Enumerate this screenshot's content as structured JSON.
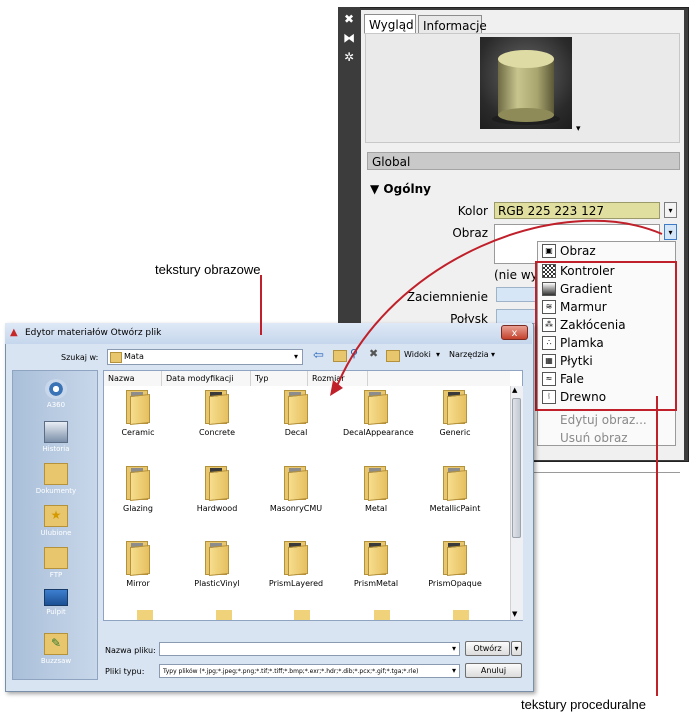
{
  "material_editor": {
    "tabs": [
      {
        "label": "Wygląd"
      },
      {
        "label": "Informacje"
      }
    ],
    "preview_caret": "▾",
    "global_label": "Global",
    "section": {
      "arrow": "▼",
      "label": "Ogólny"
    },
    "color": {
      "label": "Kolor",
      "value": "RGB 225 223 127"
    },
    "image": {
      "label": "Obraz"
    },
    "no_image_partial": "(nie wy",
    "shading_label": "Zaciemnienie",
    "gloss_label": "Połysk",
    "dropdown_arrow": "▾",
    "side_icons": [
      "close-icon",
      "pin-icon",
      "settings-icon"
    ],
    "dropdown": {
      "header": "Obraz",
      "items": [
        {
          "label": "Kontroler",
          "icon": "checker-icon"
        },
        {
          "label": "Gradient",
          "icon": "gradient-icon"
        },
        {
          "label": "Marmur",
          "icon": "marble-icon"
        },
        {
          "label": "Zakłócenia",
          "icon": "noise-icon"
        },
        {
          "label": "Plamka",
          "icon": "speckle-icon"
        },
        {
          "label": "Płytki",
          "icon": "tiles-icon"
        },
        {
          "label": "Fale",
          "icon": "waves-icon"
        },
        {
          "label": "Drewno",
          "icon": "wood-icon"
        }
      ],
      "disabled_items": [
        {
          "label": "Edytuj obraz..."
        },
        {
          "label": "Usuń obraz"
        }
      ]
    }
  },
  "file_dialog": {
    "title": "Edytor materiałów Otwórz plik",
    "close_label": "x",
    "lookin_label": "Szukaj w:",
    "lookin_value": "Mata",
    "views_label": "Widoki",
    "tools_label": "Narzędzia",
    "places": [
      {
        "label": "A360",
        "icon": "a360-icon"
      },
      {
        "label": "Historia",
        "icon": "history-icon"
      },
      {
        "label": "Dokumenty",
        "icon": "documents-icon"
      },
      {
        "label": "Ulubione",
        "icon": "favorites-icon"
      },
      {
        "label": "FTP",
        "icon": "ftp-icon"
      },
      {
        "label": "Pulpit",
        "icon": "desktop-icon"
      },
      {
        "label": "Buzzsaw",
        "icon": "buzzsaw-icon"
      }
    ],
    "columns": [
      {
        "label": "Nazwa"
      },
      {
        "label": "Data modyfikacji"
      },
      {
        "label": "Typ"
      },
      {
        "label": "Rozmiar"
      }
    ],
    "folders": [
      {
        "name": "Ceramic"
      },
      {
        "name": "Concrete"
      },
      {
        "name": "Decal"
      },
      {
        "name": "DecalAppearance"
      },
      {
        "name": "Generic"
      },
      {
        "name": "Glazing"
      },
      {
        "name": "Hardwood"
      },
      {
        "name": "MasonryCMU"
      },
      {
        "name": "Metal"
      },
      {
        "name": "MetallicPaint"
      },
      {
        "name": "Mirror"
      },
      {
        "name": "PlasticVinyl"
      },
      {
        "name": "PrismLayered"
      },
      {
        "name": "PrismMetal"
      },
      {
        "name": "PrismOpaque"
      }
    ],
    "filename_label": "Nazwa pliku:",
    "filename_value": "",
    "filetype_label": "Pliki typu:",
    "filetype_value": "Typy plików  (*.jpg;*.jpeg;*.png;*.tif;*.tiff;*.bmp;*.exr;*.hdr;*.dib;*.pcx;*.gif;*.tga;*.rle)",
    "open_button": "Otwórz",
    "cancel_button": "Anuluj"
  },
  "annotations": {
    "image_textures": "tekstury obrazowe",
    "procedural_textures": "tekstury proceduralne"
  },
  "colors": {
    "accent_red": "#c0202a",
    "color_swatch": "#e1df9f"
  }
}
